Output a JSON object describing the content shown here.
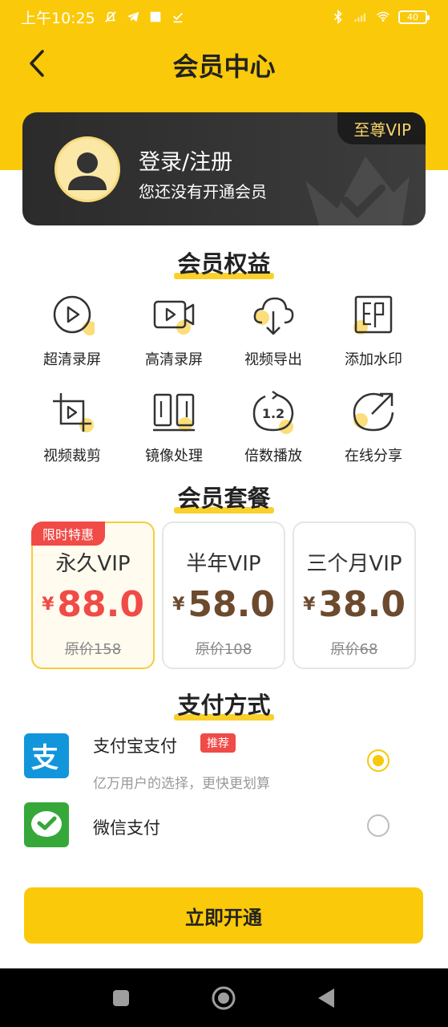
{
  "status_bar": {
    "time": "上午10:25",
    "battery": "40"
  },
  "header": {
    "title": "会员中心"
  },
  "member_card": {
    "badge": "至尊VIP",
    "login_label": "登录/注册",
    "status_text": "您还没有开通会员"
  },
  "benefits": {
    "title": "会员权益",
    "items": [
      {
        "label": "超清录屏",
        "icon": "play-circle-icon"
      },
      {
        "label": "高清录屏",
        "icon": "video-camera-icon"
      },
      {
        "label": "视频导出",
        "icon": "cloud-download-icon"
      },
      {
        "label": "添加水印",
        "icon": "stamp-icon"
      },
      {
        "label": "视频裁剪",
        "icon": "crop-icon"
      },
      {
        "label": "镜像处理",
        "icon": "mirror-icon"
      },
      {
        "label": "倍数播放",
        "icon": "speed-icon",
        "icon_text": "1.2"
      },
      {
        "label": "在线分享",
        "icon": "share-icon"
      }
    ]
  },
  "plans": {
    "title": "会员套餐",
    "items": [
      {
        "tag": "限时特惠",
        "name": "永久VIP",
        "currency": "¥",
        "price": "88.0",
        "original": "原价158",
        "selected": true
      },
      {
        "name": "半年VIP",
        "currency": "¥",
        "price": "58.0",
        "original": "原价108",
        "selected": false
      },
      {
        "name": "三个月VIP",
        "currency": "¥",
        "price": "38.0",
        "original": "原价68",
        "selected": false
      }
    ]
  },
  "payment": {
    "title": "支付方式",
    "methods": [
      {
        "name": "支付宝支付",
        "badge": "推荐",
        "subtitle": "亿万用户的选择，更快更划算",
        "icon": "alipay-icon",
        "icon_text": "支",
        "selected": true
      },
      {
        "name": "微信支付",
        "icon": "wechat-pay-icon",
        "selected": false
      }
    ]
  },
  "submit_label": "立即开通",
  "colors": {
    "primary": "#FAC909",
    "accent_red": "#F04B47",
    "price_brown": "#6B4A2E",
    "card_dark": "#333333"
  }
}
